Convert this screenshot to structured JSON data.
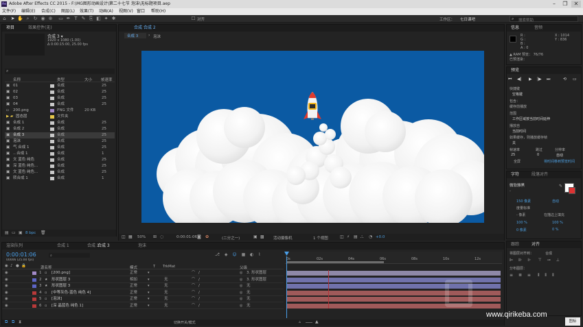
{
  "app": {
    "title": "Adobe After Effects CC 2015 - F:\\MG图形动画设计\\第二十七节 泡沫\\无标题项目.aep",
    "window_controls": [
      "–",
      "❐",
      "✕"
    ]
  },
  "menu": [
    "文件(F)",
    "编辑(E)",
    "合成(C)",
    "图层(L)",
    "效果(T)",
    "动画(A)",
    "视图(V)",
    "窗口",
    "帮助(H)"
  ],
  "toolbar": {
    "snap_label": "对齐",
    "workspace_label": "工作区：",
    "workspace_value": "七日课吧",
    "search_placeholder": "搜索帮助"
  },
  "project_panel": {
    "tabs": [
      "项目",
      "效果控件(无)"
    ],
    "selected_name": "合成 3 ▾",
    "selected_info": [
      "1920 x 1080 (1.00)",
      "Δ 0:00:15:00, 25.00 fps"
    ],
    "search_placeholder": "",
    "columns": [
      "名称",
      "类型",
      "大小",
      "帧速率"
    ],
    "items": [
      {
        "name": "01",
        "type": "合成",
        "size": "",
        "fps": "25",
        "color": "#c9c9c9",
        "kind": "comp",
        "selected": false
      },
      {
        "name": "02",
        "type": "合成",
        "size": "",
        "fps": "25",
        "color": "#c9c9c9",
        "kind": "comp",
        "selected": false
      },
      {
        "name": "03",
        "type": "合成",
        "size": "",
        "fps": "25",
        "color": "#c9c9c9",
        "kind": "comp",
        "selected": false
      },
      {
        "name": "04",
        "type": "合成",
        "size": "",
        "fps": "25",
        "color": "#c9c9c9",
        "kind": "comp",
        "selected": false
      },
      {
        "name": "200.png",
        "type": "PNG 文件",
        "size": "20 KB",
        "fps": "",
        "color": "#a38ac9",
        "kind": "file",
        "selected": false
      },
      {
        "name": "固态层",
        "type": "文件夹",
        "size": "",
        "fps": "",
        "color": "#e6c64a",
        "kind": "folder",
        "selected": false
      },
      {
        "name": "合成 1",
        "type": "合成",
        "size": "",
        "fps": "25",
        "color": "#c9c9c9",
        "kind": "comp",
        "selected": false
      },
      {
        "name": "合成 2",
        "type": "合成",
        "size": "",
        "fps": "25",
        "color": "#c9c9c9",
        "kind": "comp",
        "selected": false
      },
      {
        "name": "合成 3",
        "type": "合成",
        "size": "",
        "fps": "25",
        "color": "#c9c9c9",
        "kind": "comp",
        "selected": true
      },
      {
        "name": "泡沫",
        "type": "合成",
        "size": "",
        "fps": "25",
        "color": "#c9c9c9",
        "kind": "comp",
        "selected": false
      },
      {
        "name": "气 合成 1",
        "type": "合成",
        "size": "",
        "fps": "25",
        "color": "#c9c9c9",
        "kind": "comp",
        "selected": false
      },
      {
        "name": "...合成 1",
        "type": "合成",
        "size": "",
        "fps": "1",
        "color": "#c9c9c9",
        "kind": "comp",
        "selected": false
      },
      {
        "name": "文 蓝色 纯色",
        "type": "合成",
        "size": "",
        "fps": "25",
        "color": "#c9c9c9",
        "kind": "comp",
        "selected": false
      },
      {
        "name": "深 蓝色 纯色...",
        "type": "合成",
        "size": "",
        "fps": "25",
        "color": "#c9c9c9",
        "kind": "comp",
        "selected": false
      },
      {
        "name": "文 蓝色 纯色...",
        "type": "合成",
        "size": "",
        "fps": "25",
        "color": "#c9c9c9",
        "kind": "comp",
        "selected": false
      },
      {
        "name": "转合成 1",
        "type": "合成",
        "size": "",
        "fps": "1",
        "color": "#c9c9c9",
        "kind": "comp",
        "selected": false
      }
    ],
    "bpc": "8 bpc"
  },
  "composition_panel": {
    "tabs": [
      "合成 合成 2"
    ],
    "sub_tabs": [
      "合成 3",
      "泡沫"
    ],
    "background_color": "#0b5aa3",
    "zoom": "50%",
    "timecode": "0:00:01:06",
    "resolution": "(二分之一)",
    "camera": "活动摄像机",
    "views": "1 个视图",
    "exposure": "+0.0"
  },
  "info_panel": {
    "tabs": [
      "信息",
      "音频"
    ],
    "readout": [
      "R :",
      "G :",
      "B :",
      "A : 0"
    ],
    "coords": [
      "X : 1014",
      "Y : 836"
    ],
    "ram": "▲ RAM 预览： 76/76",
    "ram2": "已预渲染："
  },
  "preview_panel": {
    "tab": "预览",
    "shortcut_label": "快捷键",
    "shortcut_value": "空格键",
    "include_label": "包含：",
    "cache_label": "缓存前播放",
    "range_label": "范围",
    "range_value": "工作区域按当前时间延伸",
    "play_from_label": "播放自",
    "play_from_value": "当前时间",
    "frame_rate_label": "帧速率",
    "skip_label": "跳过",
    "resolution_label": "分辨率",
    "frame_rate_value": "25",
    "skip_value": "0",
    "resolution_value": "自动",
    "fullscreen_label": "全屏",
    "stop_label": "如果缓存，则播放缓存帧",
    "preview_extra": "将时间移到预览时间",
    "off_label": "关"
  },
  "character_panel": {
    "tabs": [
      "字符",
      "段落对齐"
    ],
    "font": "微软雅黑",
    "font_style": "-",
    "size": "150 像素",
    "leading": "自动",
    "tracking_label": "度量标准",
    "stroke": "- 像素",
    "stroke_type": "在描边上填充",
    "scale_v": "100 %",
    "scale_h": "100 %",
    "baseline": "0 像素",
    "tsume": "0 %"
  },
  "align_panel": {
    "tabs": [
      "跟踪",
      "对齐"
    ],
    "align_label": "将图层对齐到：",
    "align_value": "合成",
    "distribute_label": "分布图层："
  },
  "timeline": {
    "tabs": [
      "渲染队列",
      "合成 1",
      "合成 2",
      "合成 3",
      "泡沫"
    ],
    "timecode": "0:00:01:06",
    "frame_info": "00006 (25.00 fps)",
    "columns": [
      "源名称",
      "模式",
      "T",
      "TrkMat",
      "父级"
    ],
    "layers": [
      {
        "num": "1",
        "name": "[200.png]",
        "mode": "正常",
        "trkmat": "",
        "parent": "3. 形状图层",
        "color": "#a38ac9",
        "bar": "#8f89a8",
        "star": false
      },
      {
        "num": "2",
        "name": "形状图层 3",
        "mode": "相加",
        "trkmat": "无",
        "parent": "3. 形状图层",
        "color": "#5d65c6",
        "bar": "#7072ab",
        "star": true
      },
      {
        "num": "3",
        "name": "形状图层 3",
        "mode": "正常",
        "trkmat": "无",
        "parent": "无",
        "color": "#5d65c6",
        "bar": "#7072ab",
        "star": true
      },
      {
        "num": "4",
        "name": "[中等灰色-蓝色 纯色 4]",
        "mode": "正常",
        "trkmat": "无",
        "parent": "无",
        "color": "#b83a3a",
        "bar": "#a05a5a",
        "star": false
      },
      {
        "num": "5",
        "name": "[泡沫]",
        "mode": "正常",
        "trkmat": "无",
        "parent": "无",
        "color": "#b83a3a",
        "bar": "#a05a5a",
        "star": false
      },
      {
        "num": "6",
        "name": "[深 晶蓝色 纯色 1]",
        "mode": "正常",
        "trkmat": "无",
        "parent": "无",
        "color": "#b83a3a",
        "bar": "#a05a5a",
        "star": false
      }
    ],
    "ruler": [
      "0s",
      "02s",
      "04s",
      "06s",
      "08s",
      "10s",
      "12s"
    ],
    "mode_toggle": "切换开关/模式"
  },
  "watermark": {
    "url": "www.qirikeba.com",
    "corner_label": "图标"
  }
}
